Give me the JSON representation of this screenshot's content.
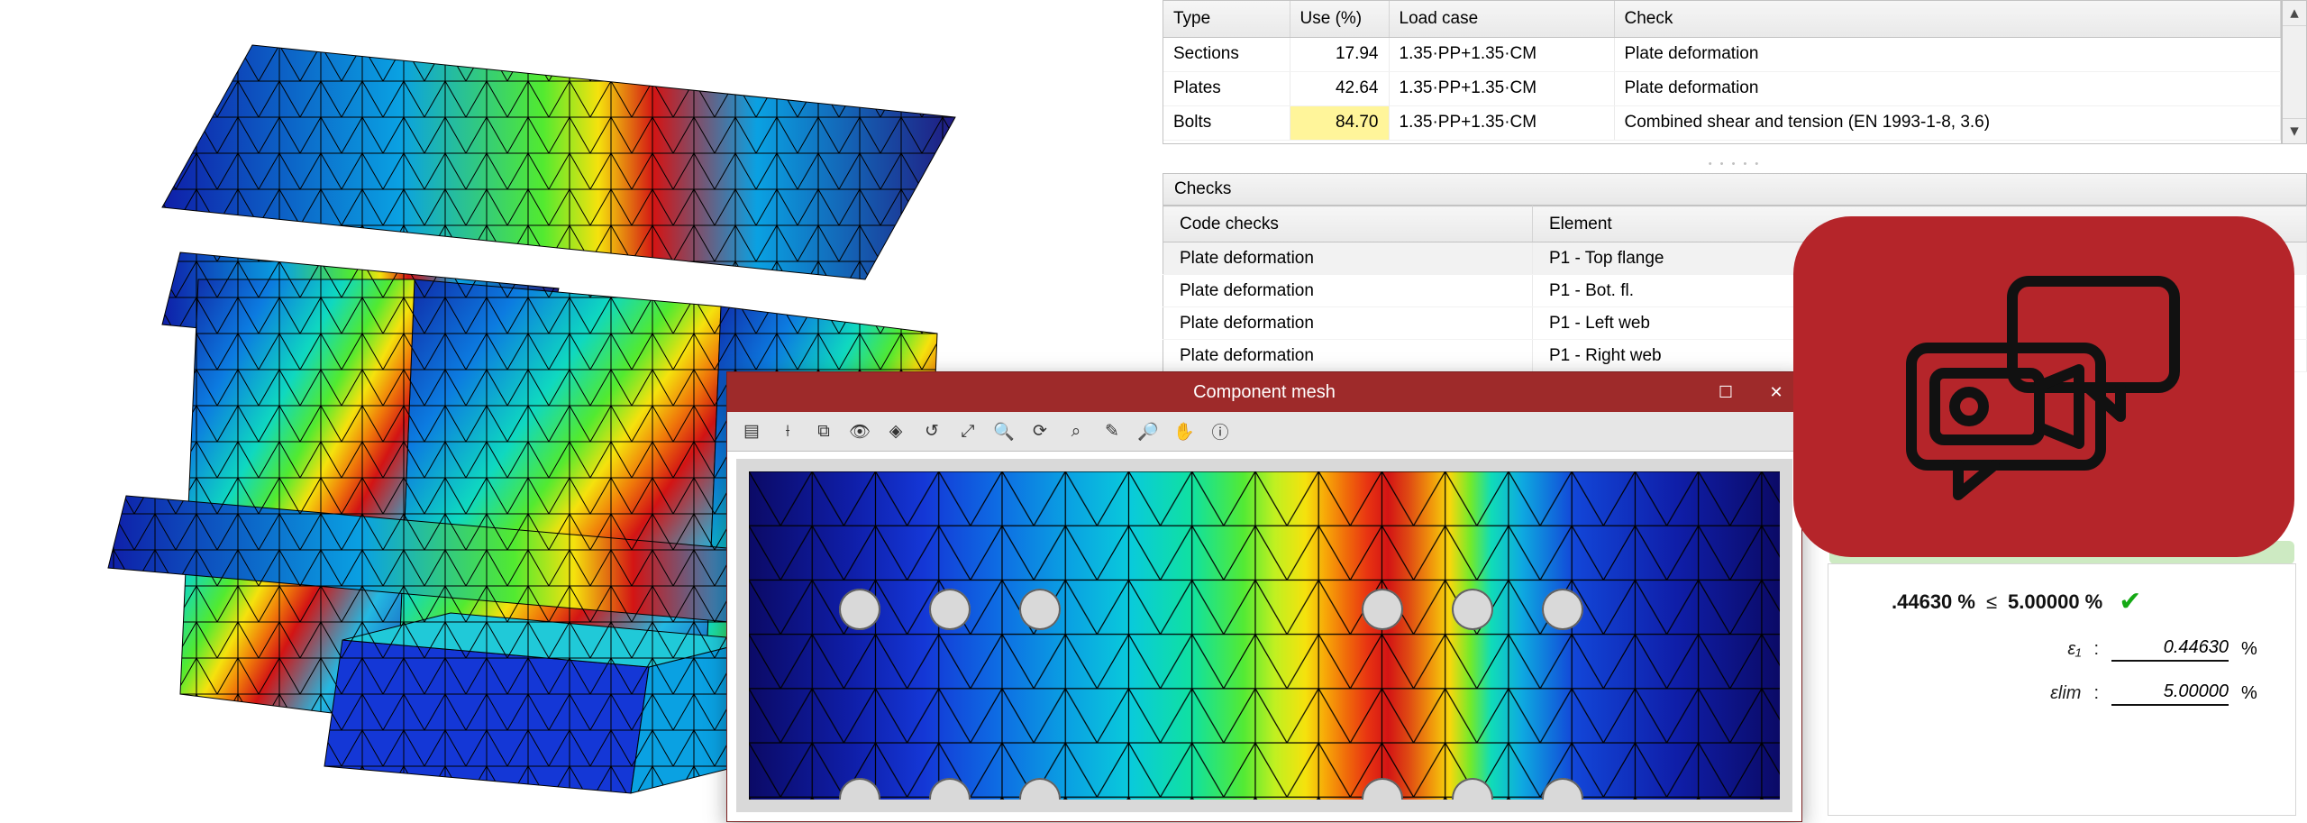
{
  "top_table": {
    "headers": {
      "type": "Type",
      "use": "Use (%)",
      "loadcase": "Load case",
      "check": "Check"
    },
    "rows": [
      {
        "type": "Sections",
        "use": "17.94",
        "loadcase": "1.35·PP+1.35·CM",
        "check": "Plate deformation",
        "highlight": false
      },
      {
        "type": "Plates",
        "use": "42.64",
        "loadcase": "1.35·PP+1.35·CM",
        "check": "Plate deformation",
        "highlight": false
      },
      {
        "type": "Bolts",
        "use": "84.70",
        "loadcase": "1.35·PP+1.35·CM",
        "check": "Combined shear and tension (EN 1993-1-8, 3.6)",
        "highlight": true
      }
    ]
  },
  "checks": {
    "title": "Checks",
    "headers": {
      "code": "Code checks",
      "element": "Element"
    },
    "rows": [
      {
        "code": "Plate deformation",
        "element": "P1 - Top flange",
        "selected": true
      },
      {
        "code": "Plate deformation",
        "element": "P1 - Bot. fl.",
        "selected": false
      },
      {
        "code": "Plate deformation",
        "element": "P1 - Left web",
        "selected": false
      },
      {
        "code": "Plate deformation",
        "element": "P1 - Right web",
        "selected": false
      }
    ]
  },
  "mesh_window": {
    "title": "Component mesh",
    "toolbar_icons": [
      "layers-icon",
      "wireframe-icon",
      "copy-icon",
      "eye-icon",
      "perspective-icon",
      "rotate-left-icon",
      "zoom-fit-icon",
      "zoom-in-icon",
      "refresh-icon",
      "zoom-area-icon",
      "pencil-icon",
      "zoom-window-icon",
      "pan-hand-icon",
      "identify-icon"
    ]
  },
  "result_detail": {
    "line1_left": ".44630 %",
    "line1_op": "≤",
    "line1_right": "5.00000 %",
    "rows": [
      {
        "label": "ε₁",
        "value": "0.44630",
        "unit": "%"
      },
      {
        "label": "εlim",
        "value": "5.00000",
        "unit": "%"
      }
    ]
  },
  "colors": {
    "titlebar": "#9e2a2a",
    "red_card": "#b5252a",
    "highlight": "#fff59a"
  }
}
